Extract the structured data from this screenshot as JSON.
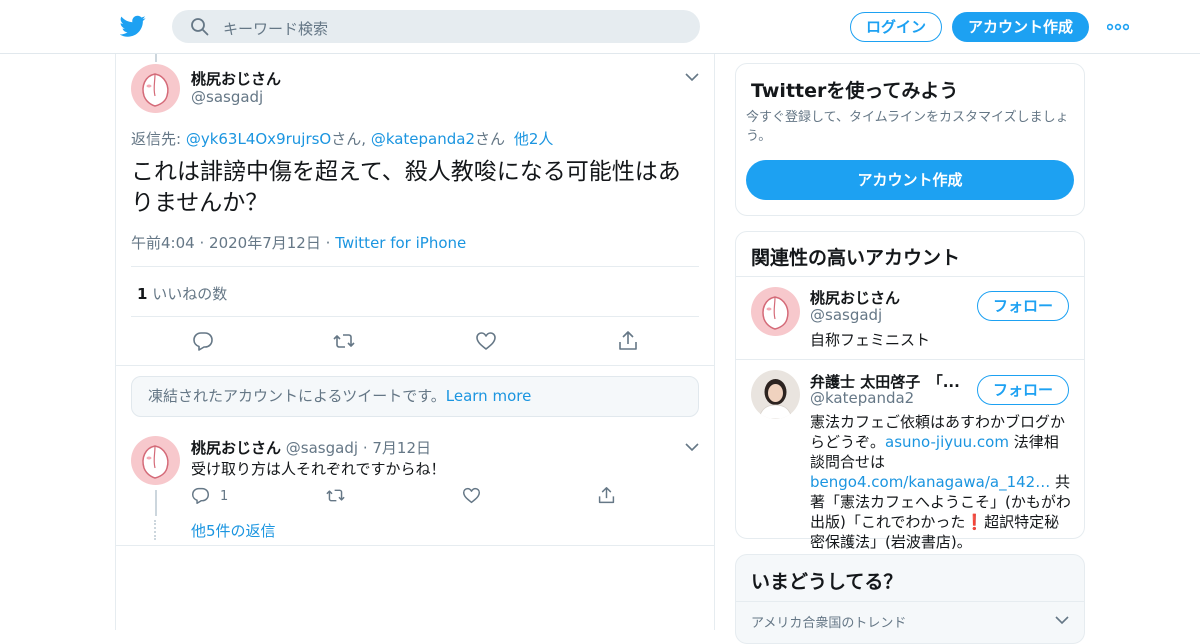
{
  "topbar": {
    "search_placeholder": "キーワード検索",
    "login_label": "ログイン",
    "signup_label": "アカウント作成",
    "brand_color": "#1da1f2",
    "icons": [
      "twitter-bird-icon",
      "search-icon",
      "more-dots-icon"
    ]
  },
  "tweet": {
    "author_name": "桃尻おじさん",
    "author_handle": "@sasgadj",
    "reply_prefix": "返信先: ",
    "reply_user1": "@yk63L4Ox9rujrsO",
    "reply_san1": "さん",
    "reply_sep": ", ",
    "reply_user2": "@katepanda2",
    "reply_san2": "さん",
    "reply_others": "他2人",
    "text": "これは誹謗中傷を超えて、殺人教唆になる可能性はありませんか？",
    "time": "午前4:04",
    "dot": "·",
    "date": "2020年7月12日",
    "source": "Twitter for iPhone",
    "like_count": "1",
    "like_label": "いいねの数",
    "actions": [
      "reply-icon",
      "retweet-icon",
      "like-icon",
      "share-icon"
    ]
  },
  "notice": {
    "text": "凍結されたアカウントによるツイートです。",
    "link": "Learn more"
  },
  "reply": {
    "author_name": "桃尻おじさん",
    "author_handle": "@sasgadj",
    "dot": "·",
    "date": "7月12日",
    "text": "受け取り方は人それぞれですからね！",
    "reply_count": "1",
    "more_replies": "他5件の返信"
  },
  "signup_card": {
    "title": "Twitterを使ってみよう",
    "desc": "今すぐ登録して、タイムラインをカスタマイズしましょう。",
    "button": "アカウント作成"
  },
  "related": {
    "title": "関連性の高いアカウント",
    "follow_label": "フォロー",
    "accounts": [
      {
        "name": "桃尻おじさん",
        "handle": "@sasgadj",
        "bio": "自称フェミニスト"
      },
      {
        "name": "弁護士 太田啓子　「...",
        "handle": "@katepanda2",
        "bio_1": "憲法カフェご依頼はあすわかブログからどうぞ。",
        "bio_link1": "asuno-jiyuu.com",
        "bio_2": " 法律相談問合せは",
        "bio_link2": "bengo4.com/kanagawa/a_142…",
        "bio_3": " 共著「憲法カフェへようこそ」(かもがわ出版)「これでわかった",
        "bio_emoji": "❗",
        "bio_4": "超訳特定秘密保護法」(岩波書店)。"
      }
    ]
  },
  "trends": {
    "title": "いまどうしてる？",
    "region": "アメリカ合衆国のトレンド"
  }
}
